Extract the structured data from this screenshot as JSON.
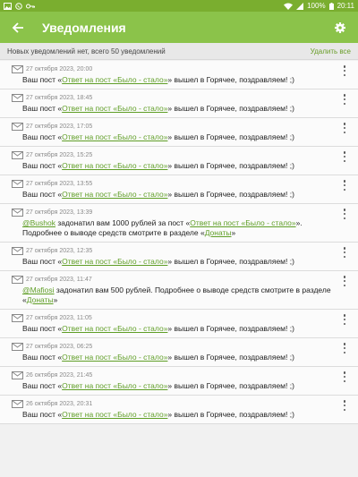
{
  "status_bar": {
    "time": "20:11",
    "battery": "100%"
  },
  "app_bar": {
    "title": "Уведомления"
  },
  "summary": {
    "text": "Новых уведомлений нет, всего 50 уведомлений",
    "delete_all": "Удалить все"
  },
  "notifications": [
    {
      "date": "27 октября 2023, 20:00",
      "pre": "Ваш пост «",
      "link": "Ответ на пост «Было - стало»",
      "post": "» вышел в Горячее, поздравляем! ;)"
    },
    {
      "date": "27 октября 2023, 18:45",
      "pre": "Ваш пост «",
      "link": "Ответ на пост «Было - стало»",
      "post": "» вышел в Горячее, поздравляем! ;)"
    },
    {
      "date": "27 октября 2023, 17:05",
      "pre": "Ваш пост «",
      "link": "Ответ на пост «Было - стало»",
      "post": "» вышел в Горячее, поздравляем! ;)"
    },
    {
      "date": "27 октября 2023, 15:25",
      "pre": "Ваш пост «",
      "link": "Ответ на пост «Было - стало»",
      "post": "» вышел в Горячее, поздравляем! ;)"
    },
    {
      "date": "27 октября 2023, 13:55",
      "pre": "Ваш пост «",
      "link": "Ответ на пост «Было - стало»",
      "post": "» вышел в Горячее, поздравляем! ;)"
    },
    {
      "date": "27 октября 2023, 13:39",
      "user": "@Bushok",
      "pre": " задонатил вам 1000 рублей за пост «",
      "link": "Ответ на пост «Было - стало»",
      "post": "». Подробнее о выводе средств смотрите в разделе «",
      "link2": "Донаты",
      "post2": "»"
    },
    {
      "date": "27 октября 2023, 12:35",
      "pre": "Ваш пост «",
      "link": "Ответ на пост «Было - стало»",
      "post": "» вышел в Горячее, поздравляем! ;)"
    },
    {
      "date": "27 октября 2023, 11:47",
      "user": "@Mafiosi",
      "pre": " задонатил вам 500 рублей. Подробнее о выводе средств смотрите в разделе «",
      "link": "Донаты",
      "post": "»"
    },
    {
      "date": "27 октября 2023, 11:05",
      "pre": "Ваш пост «",
      "link": "Ответ на пост «Было - стало»",
      "post": "» вышел в Горячее, поздравляем! ;)"
    },
    {
      "date": "27 октября 2023, 06:25",
      "pre": "Ваш пост «",
      "link": "Ответ на пост «Было - стало»",
      "post": "» вышел в Горячее, поздравляем! ;)"
    },
    {
      "date": "26 октября 2023, 21:45",
      "pre": "Ваш пост «",
      "link": "Ответ на пост «Было - стало»",
      "post": "» вышел в Горячее, поздравляем! ;)"
    },
    {
      "date": "26 октября 2023, 20:31",
      "pre": "Ваш пост «",
      "link": "Ответ на пост «Было - стало»",
      "post": "» вышел в Горячее, поздравляем! ;)"
    }
  ],
  "colors": {
    "app_bar": "#8bc34a",
    "status_bar": "#7aae2f",
    "link": "#5f9e26"
  },
  "icons": {
    "back": "arrow-left-icon",
    "settings": "gear-icon",
    "more": "more-vert-icon",
    "envelope": "envelope-icon"
  }
}
